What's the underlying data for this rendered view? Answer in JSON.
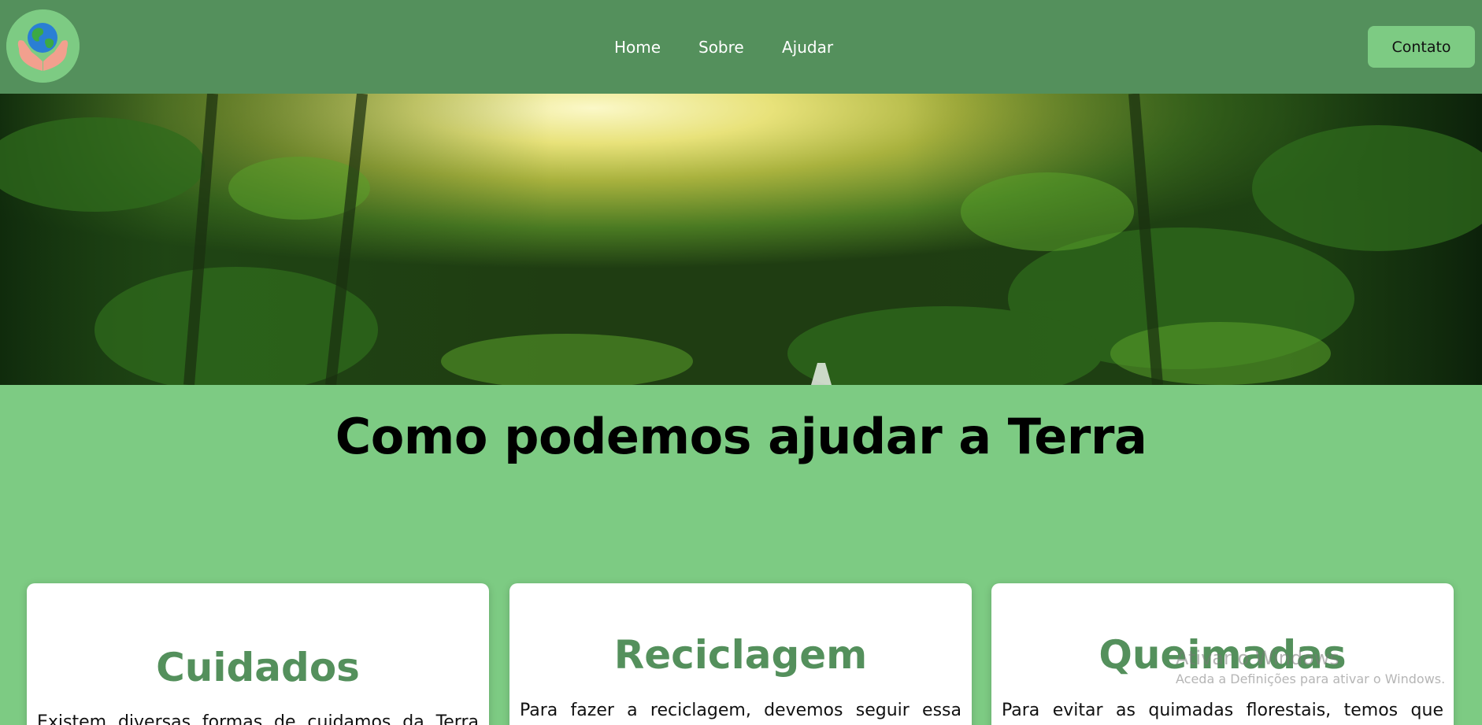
{
  "navbar": {
    "logo_icon": "earth-in-hands-icon",
    "links": [
      {
        "label": "Home"
      },
      {
        "label": "Sobre"
      },
      {
        "label": "Ajudar"
      }
    ],
    "contact_label": "Contato"
  },
  "hero": {
    "image": "rainforest-sunlight-banner"
  },
  "main": {
    "title": "Como podemos ajudar a Terra"
  },
  "cards": [
    {
      "title": "Cuidados",
      "text": "Existem diversas formas de cuidamos da Terra"
    },
    {
      "title": "Reciclagem",
      "text": "Para fazer a reciclagem, devemos seguir essa"
    },
    {
      "title": "Queimadas",
      "text": "Para evitar as quimadas florestais, temos que"
    }
  ],
  "watermark": {
    "title": "Ativar o Windows",
    "subtitle": "Aceda a Definições para ativar o Windows."
  },
  "colors": {
    "navbar_bg": "#54905c",
    "page_bg": "#7dcb83",
    "card_title": "#54905c",
    "card_bg": "#ffffff"
  }
}
